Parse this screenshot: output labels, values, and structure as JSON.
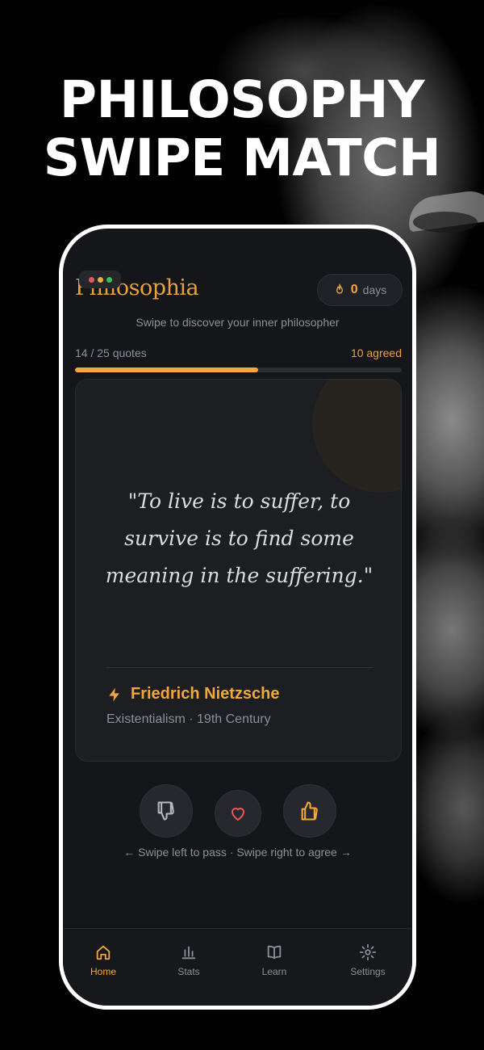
{
  "promo": {
    "headline_line1": "PHILOSOPHY",
    "headline_line2": "SWIPE MATCH"
  },
  "app": {
    "brand": "Philosophia",
    "streak": {
      "value": "0",
      "unit": "days",
      "icon": "flame-icon"
    },
    "tagline": "Swipe to discover your inner philosopher",
    "progress": {
      "label": "14 / 25 quotes",
      "agreed": "10 agreed",
      "fraction": 0.56
    }
  },
  "card": {
    "quote": "\"To live is to suffer, to survive is to find some meaning in the suffering.\"",
    "author_icon": "lightning-icon",
    "author": "Friedrich Nietzsche",
    "meta": "Existentialism · 19th Century"
  },
  "actions": {
    "pass_icon": "thumbs-down-icon",
    "like_icon": "heart-icon",
    "agree_icon": "thumbs-up-icon",
    "hint": "← Swipe left to pass · Swipe right to agree →"
  },
  "tabs": [
    {
      "label": "Home",
      "icon": "home-icon",
      "active": true
    },
    {
      "label": "Stats",
      "icon": "bar-chart-icon",
      "active": false
    },
    {
      "label": "Learn",
      "icon": "book-icon",
      "active": false
    },
    {
      "label": "Settings",
      "icon": "gear-icon",
      "active": false
    }
  ],
  "colors": {
    "accent": "#f0a83a",
    "background": "#151619",
    "card": "#1d1e22",
    "heart": "#e8575b"
  }
}
